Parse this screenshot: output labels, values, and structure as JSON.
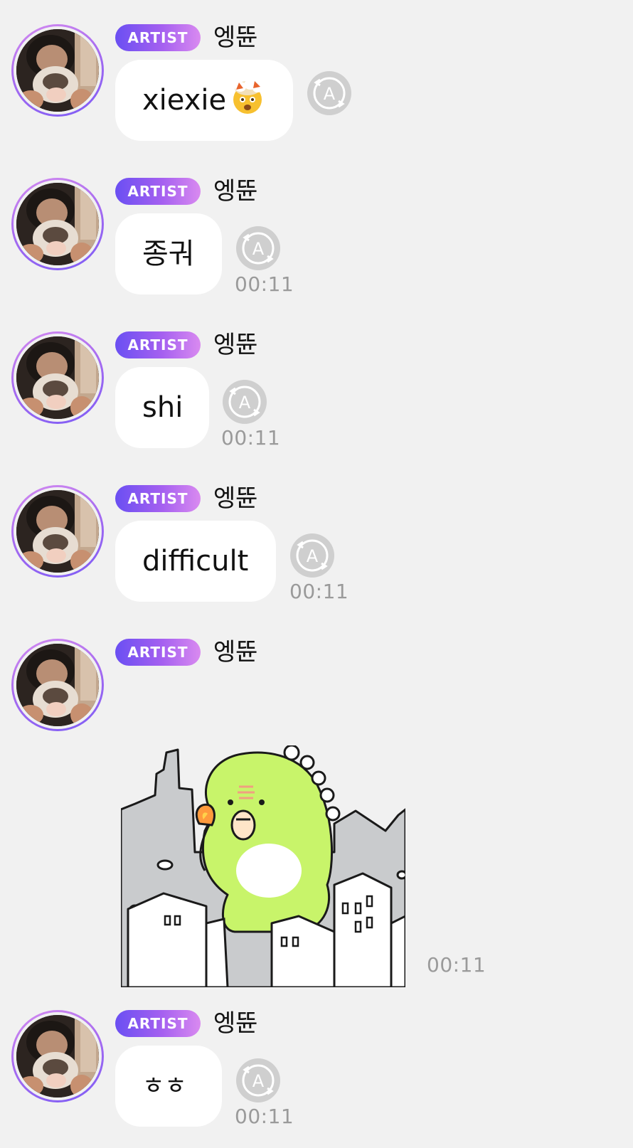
{
  "badge_label": "ARTIST",
  "author_name": "엥뜐",
  "messages": [
    {
      "type": "text",
      "text": "xiexie",
      "emoji": "exploding-head-emoji",
      "time": ""
    },
    {
      "type": "text",
      "text": "종궈",
      "time": "00:11"
    },
    {
      "type": "text",
      "text": "shi",
      "time": "00:11"
    },
    {
      "type": "text",
      "text": "difficult",
      "time": "00:11"
    },
    {
      "type": "sticker",
      "sticker": "green-dinosaur-sticker",
      "time": "00:11"
    },
    {
      "type": "text",
      "text": "ㅎㅎ",
      "time": "00:11"
    }
  ],
  "colors": {
    "background": "#f1f1f1",
    "bubble": "#ffffff",
    "badge_start": "#6a4ff2",
    "badge_end": "#d98af0",
    "timestamp": "#9a9a9a",
    "translate_icon": "#c8c8c8",
    "sticker_dino": "#c8f46a"
  }
}
